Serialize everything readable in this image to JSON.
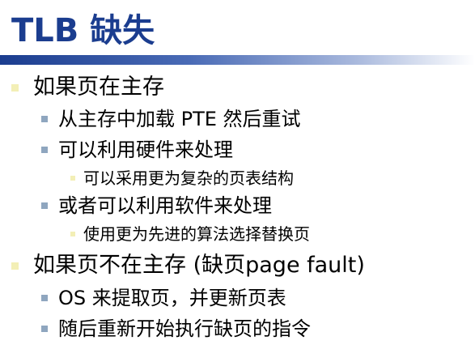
{
  "slide": {
    "title": "TLB 缺失",
    "colors": {
      "title_text": "#1b3d8f",
      "bar_start": "#1b3d8f",
      "bar_end": "#ffffff",
      "bullet_level1": "#f3efb6",
      "bullet_level2": "#8fa6bf",
      "bullet_level3": "#f3efb6"
    },
    "bullets": [
      {
        "level": 1,
        "text": "如果页在主存"
      },
      {
        "level": 2,
        "text": "从主存中加载 PTE 然后重试"
      },
      {
        "level": 2,
        "text": "可以利用硬件来处理"
      },
      {
        "level": 3,
        "text": "可以采用更为复杂的页表结构"
      },
      {
        "level": 2,
        "text": "或者可以利用软件来处理"
      },
      {
        "level": 3,
        "text": "使用更为先进的算法选择替换页"
      },
      {
        "level": 1,
        "text": "如果页不在主存 (缺页page fault)"
      },
      {
        "level": 2,
        "text": "OS 来提取页，并更新页表"
      },
      {
        "level": 2,
        "text": "随后重新开始执行缺页的指令"
      }
    ]
  }
}
